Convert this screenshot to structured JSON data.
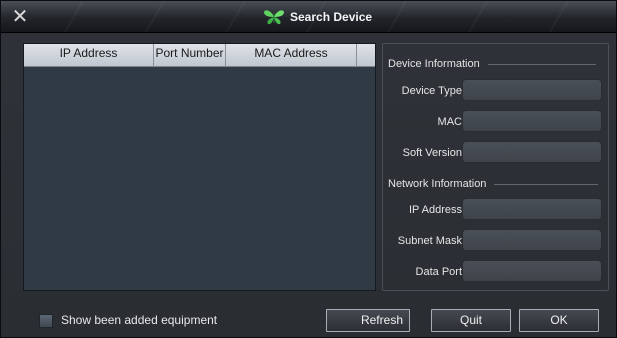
{
  "window": {
    "title": "Search Device",
    "close_glyph": "✕",
    "app_icon": "butterfly-icon",
    "accent_color": "#5fd35f"
  },
  "device_list": {
    "columns": [
      "IP Address",
      "Port Number",
      "MAC Address",
      ""
    ],
    "rows": []
  },
  "device_information": {
    "section_title": "Device Information",
    "fields": [
      {
        "label": "Device Type",
        "value": ""
      },
      {
        "label": "MAC",
        "value": ""
      },
      {
        "label": "Soft Version",
        "value": ""
      }
    ]
  },
  "network_information": {
    "section_title": "Network Information",
    "fields": [
      {
        "label": "IP Address",
        "value": ""
      },
      {
        "label": "Subnet Mask",
        "value": ""
      },
      {
        "label": "Data Port",
        "value": ""
      }
    ]
  },
  "footer": {
    "show_added_label": "Show been added equipment",
    "show_added_checked": false,
    "refresh_label": "Refresh",
    "quit_label": "Quit",
    "ok_label": "OK"
  }
}
